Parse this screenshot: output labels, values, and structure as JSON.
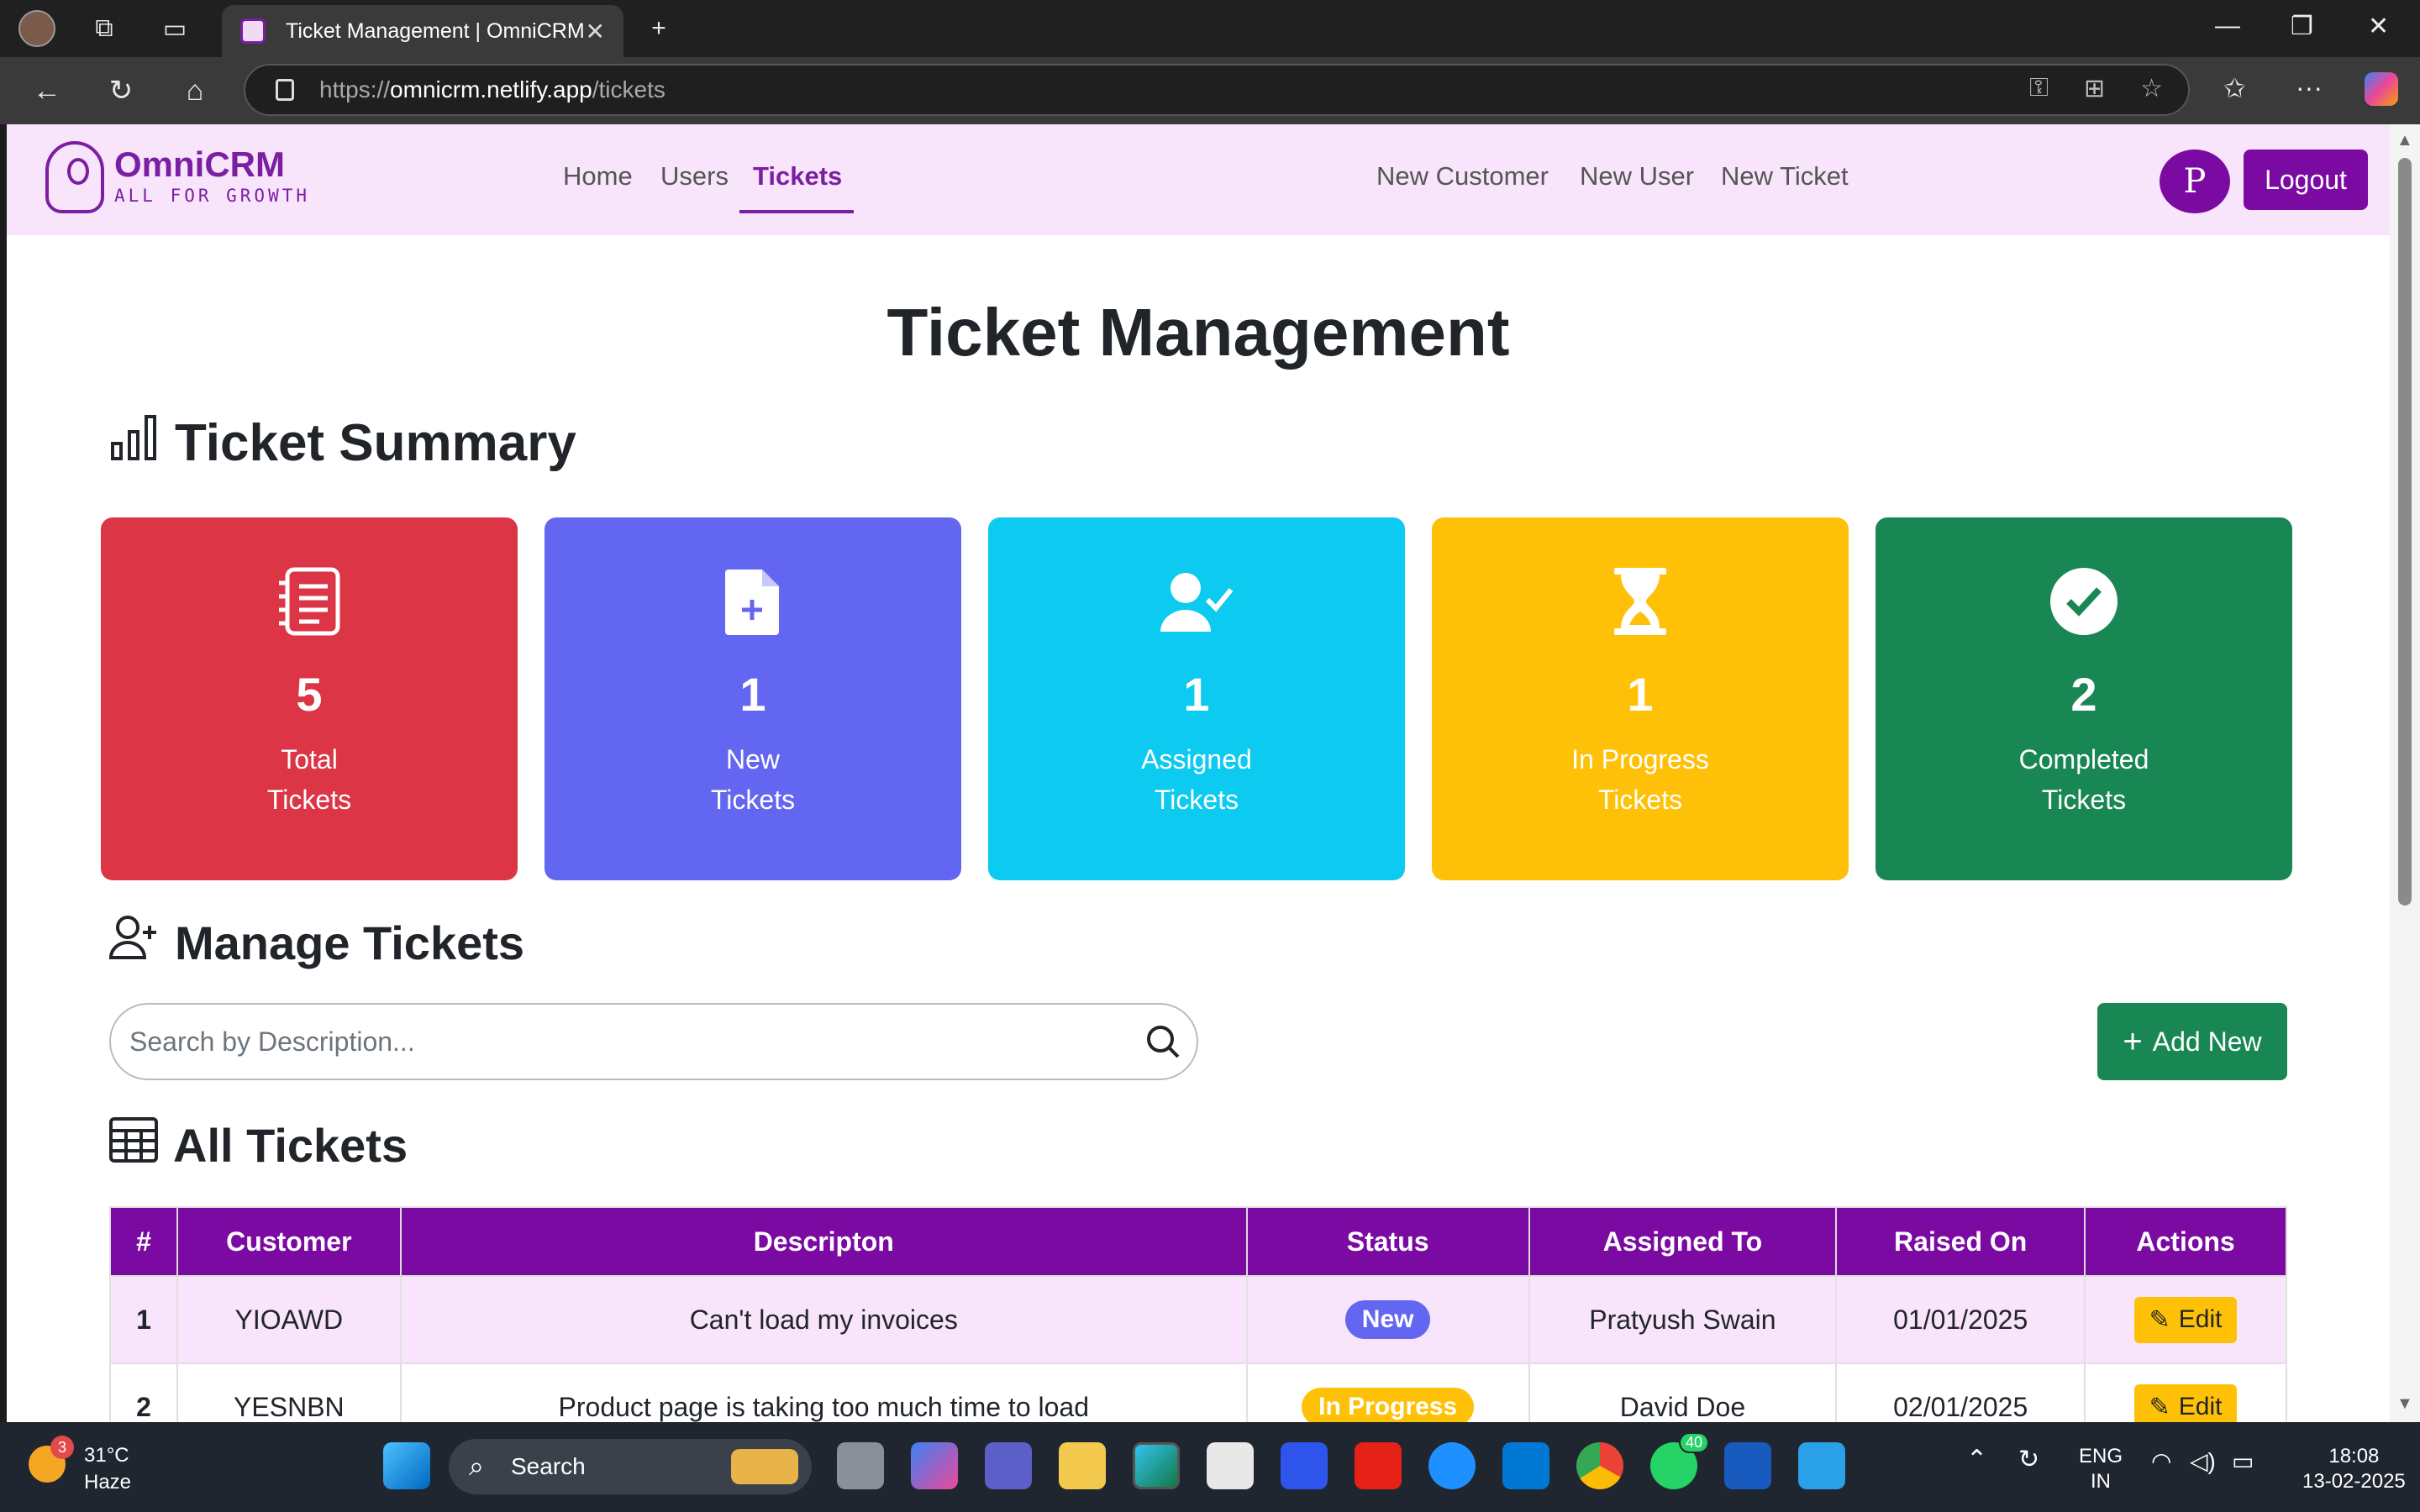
{
  "browser": {
    "tab_title": "Ticket Management | OmniCRM",
    "url_scheme": "https://",
    "url_host": "omnicrm.netlify.app",
    "url_path": "/tickets"
  },
  "app": {
    "logo_name": "OmniCRM",
    "logo_tagline": "ALL FOR GROWTH",
    "nav": [
      "Home",
      "Users",
      "Tickets"
    ],
    "active_nav": "Tickets",
    "quick_links": [
      "New Customer",
      "New User",
      "New Ticket"
    ],
    "avatar_initial": "P",
    "logout_label": "Logout"
  },
  "page": {
    "title": "Ticket Management",
    "summary_title": "Ticket Summary",
    "manage_title": "Manage Tickets",
    "all_title": "All Tickets",
    "search_placeholder": "Search by Description...",
    "add_new_label": "Add New"
  },
  "cards": [
    {
      "count": "5",
      "line1": "Total",
      "line2": "Tickets",
      "color": "#dc3545",
      "icon": "list-icon"
    },
    {
      "count": "1",
      "line1": "New",
      "line2": "Tickets",
      "color": "#6366f1",
      "icon": "new-file-icon"
    },
    {
      "count": "1",
      "line1": "Assigned",
      "line2": "Tickets",
      "color": "#0dcaf0",
      "icon": "user-check-icon"
    },
    {
      "count": "1",
      "line1": "In Progress",
      "line2": "Tickets",
      "color": "#ffc107",
      "icon": "hourglass-icon"
    },
    {
      "count": "2",
      "line1": "Completed",
      "line2": "Tickets",
      "color": "#198754",
      "icon": "check-circle-icon"
    }
  ],
  "table": {
    "headers": [
      "#",
      "Customer",
      "Descripton",
      "Status",
      "Assigned To",
      "Raised On",
      "Actions"
    ],
    "rows": [
      {
        "idx": "1",
        "customer": "YIOAWD",
        "description": "Can't load my invoices",
        "status": "New",
        "status_color": "#6366f1",
        "assigned": "Pratyush Swain",
        "raised": "01/01/2025",
        "action": "Edit"
      },
      {
        "idx": "2",
        "customer": "YESNBN",
        "description": "Product page is taking too much time to load",
        "status": "In Progress",
        "status_color": "#ffc107",
        "assigned": "David Doe",
        "raised": "02/01/2025",
        "action": "Edit"
      }
    ]
  },
  "taskbar": {
    "temperature": "31°C",
    "weather": "Haze",
    "weather_badge": "3",
    "search_label": "Search",
    "whatsapp_badge": "40",
    "lang_1": "ENG",
    "lang_2": "IN",
    "time": "18:08",
    "date": "13-02-2025"
  }
}
